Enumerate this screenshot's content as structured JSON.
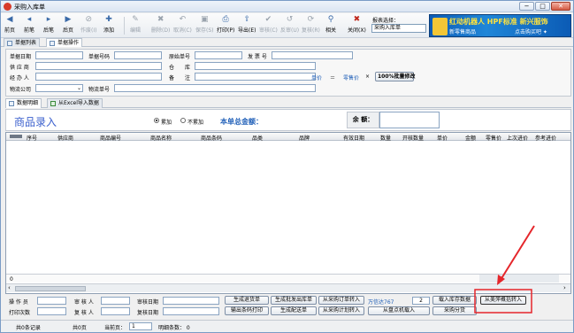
{
  "window": {
    "title": "采购入库单",
    "minimize": "−",
    "maximize": "□",
    "close": "✕"
  },
  "toolbar": {
    "buttons": [
      {
        "label": "前页",
        "icon": "◀"
      },
      {
        "label": "前笔",
        "icon": "◂"
      },
      {
        "label": "后笔",
        "icon": "▸"
      },
      {
        "label": "后页",
        "icon": "▶"
      },
      {
        "label": "作废(I)",
        "icon": "⊘"
      },
      {
        "label": "添加",
        "icon": "✚"
      },
      {
        "label": "编辑",
        "icon": "✎"
      },
      {
        "label": "删除(D)",
        "icon": "✖"
      },
      {
        "label": "取消(C)",
        "icon": "↶"
      },
      {
        "label": "保存(S)",
        "icon": "▣"
      },
      {
        "label": "打印(P)",
        "icon": "⎙"
      },
      {
        "label": "导出(E)",
        "icon": "⇪"
      },
      {
        "label": "审核(C)",
        "icon": "✔"
      },
      {
        "label": "反审(U)",
        "icon": "↺"
      },
      {
        "label": "复核(R)",
        "icon": "⟳"
      },
      {
        "label": "相关",
        "icon": "⚲"
      },
      {
        "label": "关闭(X)",
        "icon": "✖"
      }
    ],
    "report_label": "报表选择：",
    "report_value": "采购入库单",
    "banner": {
      "line1": "红动机器人 HPF标准 新兴服饰",
      "line2": "新零售商品",
      "line3": "点击购买吧 ✦"
    }
  },
  "tabs": {
    "list": "单据列表",
    "operate": "单据操作"
  },
  "form": {
    "doc_date": "单据日期",
    "doc_no": "单据号码",
    "orig_no": "原始单号",
    "invoice": "发 票 号",
    "supplier": "供 应 商",
    "warehouse": "仓　　库",
    "handler": "经 办 人",
    "remark": "备　　注",
    "unit_price": "单价",
    "equals": "＝",
    "retail_price": "零售价",
    "times": "×",
    "pct": "100",
    "pct_btn": "%批量修改",
    "logistics": "物流公司",
    "logistics_no": "物流单号"
  },
  "subtabs": {
    "detail": "数据明细",
    "excel": "从Excel导入数据"
  },
  "entry": {
    "title": "商品录入",
    "accumulate": "累加",
    "no_accumulate": "不累加",
    "total_label": "本单总金额：",
    "balance_label": "余 额："
  },
  "grid": {
    "columns": [
      "序号",
      "供应商",
      "商品编号",
      "商品名称",
      "商品条码",
      "品类",
      "品牌",
      "有效日期",
      "数量",
      "开核数量",
      "单价",
      "金额",
      "零售价",
      "上次进价",
      "参考进价"
    ],
    "footer_value": "0"
  },
  "bottom": {
    "operator": "操 作 员",
    "auditor": "审 核 人",
    "audit_date": "审核日期",
    "print_count": "打印次数",
    "reviewer": "复 核 人",
    "review_date": "复核日期",
    "btn_return": "生成退货单",
    "btn_batch": "生成批发出库单",
    "btn_from_po": "从采购订单转入",
    "wanxin": "万信达767",
    "wanxin_val": "2",
    "btn_stock": "载入库存数据",
    "btn_from_summary": "从美萍概括转入",
    "btn_print_barcode": "输出条码打印",
    "btn_dist": "生成配送单",
    "btn_from_plan": "从采购计划转入",
    "btn_pda": "从盘点机载入",
    "btn_split": "采购分货"
  },
  "status": {
    "records": "共0条记录",
    "pages": "共0页",
    "curpage_label": "当前页：",
    "curpage": "1",
    "detail": "明细条数： 0"
  }
}
